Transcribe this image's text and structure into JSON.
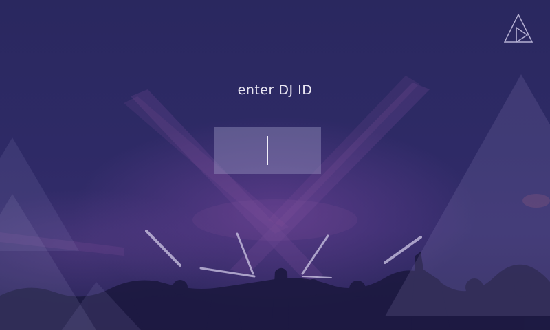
{
  "prompt": {
    "title": "enter DJ ID"
  },
  "dj_id_input": {
    "value": "",
    "placeholder": ""
  },
  "icons": {
    "logo": "triangle-play-logo-icon"
  },
  "colors": {
    "background": "#2a275e",
    "input_fill": "#9692be",
    "text": "#e9e6f3"
  }
}
